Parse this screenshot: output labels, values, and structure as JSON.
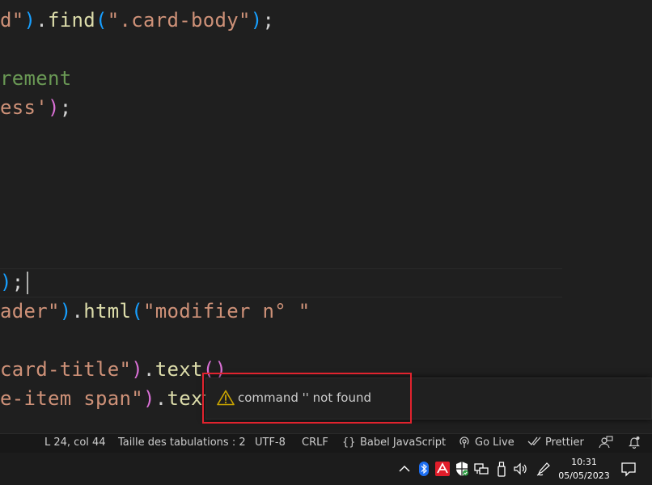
{
  "editor": {
    "lines": [
      [
        {
          "c": "t-str",
          "t": "d\""
        },
        {
          "c": "t-p2",
          "t": ")"
        },
        {
          "c": "t-pl",
          "t": "."
        },
        {
          "c": "t-fn",
          "t": "find"
        },
        {
          "c": "t-p2",
          "t": "("
        },
        {
          "c": "t-str",
          "t": "\".card-body\""
        },
        {
          "c": "t-p2",
          "t": ")"
        },
        {
          "c": "t-pl",
          "t": ";"
        }
      ],
      [
        {
          "c": "t-cm",
          "t": "rement"
        }
      ],
      [
        {
          "c": "t-str",
          "t": "ess'"
        },
        {
          "c": "t-p1",
          "t": ")"
        },
        {
          "c": "t-pl",
          "t": ";"
        }
      ],
      [
        {
          "c": "t-p2",
          "t": ")"
        },
        {
          "c": "t-pl",
          "t": ";"
        }
      ],
      [
        {
          "c": "t-str",
          "t": "ader\""
        },
        {
          "c": "t-p2",
          "t": ")"
        },
        {
          "c": "t-pl",
          "t": "."
        },
        {
          "c": "t-fn",
          "t": "html"
        },
        {
          "c": "t-p2",
          "t": "("
        },
        {
          "c": "t-str",
          "t": "\"modifier n° \""
        }
      ],
      [
        {
          "c": "t-str",
          "t": "card-title\""
        },
        {
          "c": "t-p1",
          "t": ")"
        },
        {
          "c": "t-pl",
          "t": "."
        },
        {
          "c": "t-fn",
          "t": "text"
        },
        {
          "c": "t-p1",
          "t": "("
        },
        {
          "c": "t-p1",
          "t": ")"
        }
      ],
      [
        {
          "c": "t-str",
          "t": "e-item span\""
        },
        {
          "c": "t-p1",
          "t": ")"
        },
        {
          "c": "t-pl",
          "t": "."
        },
        {
          "c": "t-fn",
          "t": "text"
        }
      ]
    ]
  },
  "notification": {
    "icon": "warning-icon",
    "message": "command '' not found"
  },
  "statusbar": {
    "position": "L 24, col 44",
    "tab_size": "Taille des tabulations : 2",
    "encoding": "UTF-8",
    "eol": "CRLF",
    "language_icon": "{}",
    "language": "Babel JavaScript",
    "golive": "Go Live",
    "prettier": "Prettier"
  },
  "taskbar": {
    "time": "10:31",
    "date": "05/05/2023"
  },
  "colors": {
    "highlight": "#e1232e",
    "warning": "#cca700"
  }
}
